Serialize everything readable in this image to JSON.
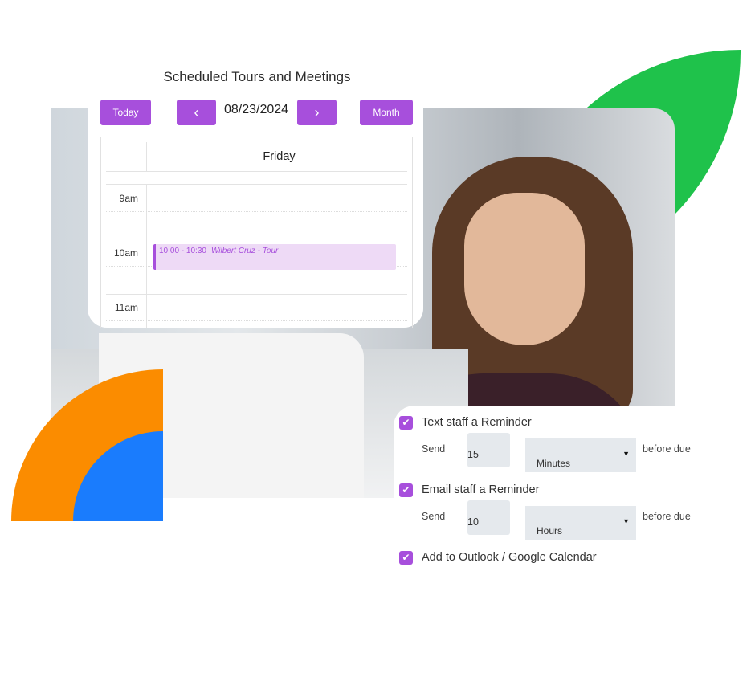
{
  "calendar": {
    "title": "Scheduled Tours and Meetings",
    "today_label": "Today",
    "prev_label": "‹",
    "next_label": "›",
    "date": "08/23/2024",
    "view_label": "Month",
    "day_header": "Friday",
    "hours": [
      "9am",
      "10am",
      "11am"
    ],
    "event": {
      "time": "10:00 - 10:30",
      "title": "Wilbert Cruz - Tour"
    }
  },
  "reminders": {
    "text_staff": {
      "label": "Text staff a Reminder",
      "checked": true,
      "send_label": "Send",
      "value": "15",
      "unit": "Minutes",
      "suffix": "before due"
    },
    "email_staff": {
      "label": "Email staff a Reminder",
      "checked": true,
      "send_label": "Send",
      "value": "10",
      "unit": "Hours",
      "suffix": "before due"
    },
    "calendar_sync": {
      "label": "Add to Outlook / Google Calendar",
      "checked": true
    }
  },
  "colors": {
    "accent": "#a74fdc",
    "green": "#1fc24b",
    "orange": "#fb8c00",
    "blue": "#1a7cfd"
  }
}
